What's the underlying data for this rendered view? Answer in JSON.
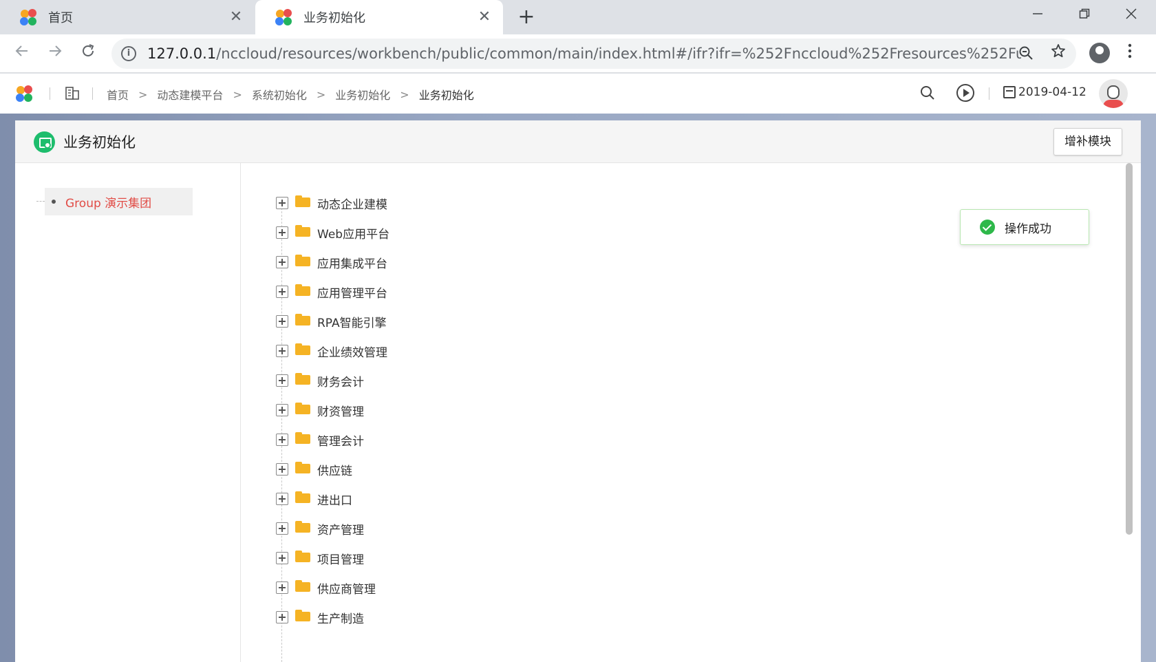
{
  "browser": {
    "tabs": [
      {
        "title": "首页"
      },
      {
        "title": "业务初始化"
      }
    ],
    "tab_close_glyph": "✕",
    "new_tab_glyph": "+",
    "url_host": "127.0.0.1",
    "url_path": "/nccloud/resources/workbench/public/common/main/index.html#/ifr?ifr=%252Fnccloud%252Fresources%252Fu...",
    "icons": [
      "back-arrow-icon",
      "forward-arrow-icon",
      "reload-icon",
      "info-icon",
      "zoom-icon",
      "star-icon",
      "account-icon",
      "menu-dots-icon",
      "minimize-icon",
      "restore-icon",
      "close-icon"
    ]
  },
  "header": {
    "breadcrumbs": [
      "首页",
      "动态建模平台",
      "系统初始化",
      "业务初始化",
      "业务初始化"
    ],
    "date": "2019-04-12",
    "icons": [
      "search-icon",
      "play-icon",
      "calendar-icon",
      "avatar"
    ]
  },
  "page": {
    "title": "业务初始化",
    "add_module_label": "增补模块"
  },
  "left_tree": {
    "group_label": "Group 演示集团"
  },
  "modules": [
    "动态企业建模",
    "Web应用平台",
    "应用集成平台",
    "应用管理平台",
    "RPA智能引擎",
    "企业绩效管理",
    "财务会计",
    "财资管理",
    "管理会计",
    "供应链",
    "进出口",
    "资产管理",
    "项目管理",
    "供应商管理",
    "生产制造"
  ],
  "toast": {
    "message": "操作成功"
  },
  "colors": {
    "accent_red": "#e14c46",
    "success_green": "#2eb84a",
    "folder_yellow": "#f5b324",
    "page_icon_green": "#1ebd6d"
  }
}
